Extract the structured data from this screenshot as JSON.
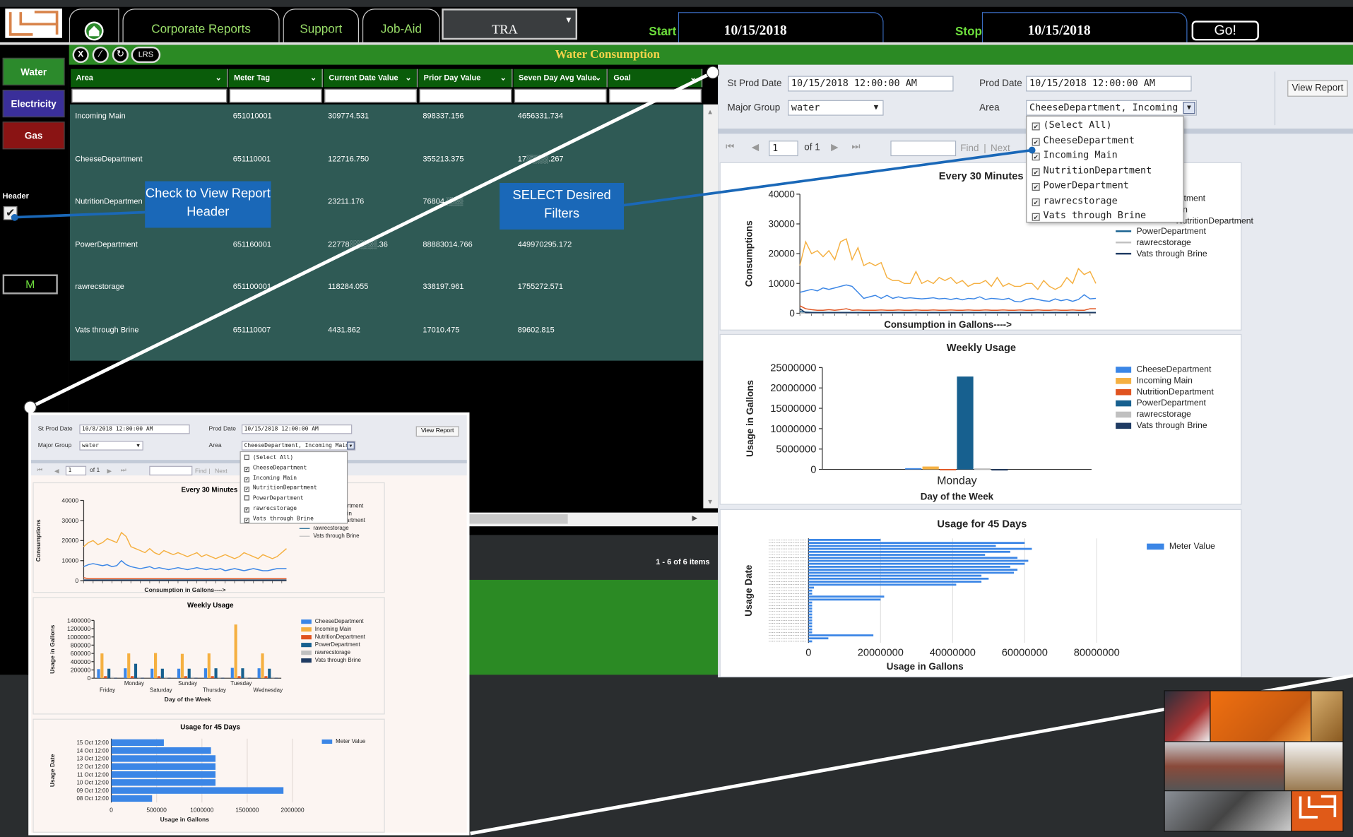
{
  "nav": {
    "tabs": [
      "Corporate Reports",
      "Support",
      "Job-Aid"
    ],
    "dropdown_value": "TRA",
    "start_label": "Start",
    "start_date": "10/15/2018",
    "stop_label": "Stop",
    "stop_date": "10/15/2018",
    "go_label": "Go!"
  },
  "sidebar": {
    "buttons": [
      {
        "label": "Water",
        "color": "#2c8a2c"
      },
      {
        "label": "Electricity",
        "color": "#3a2f9a"
      },
      {
        "label": "Gas",
        "color": "#8a1414"
      }
    ],
    "header_label": "Header",
    "m_label": "M"
  },
  "toolbar": {
    "x": "X",
    "lrs": "LRS"
  },
  "grid": {
    "title": "Water Consumption",
    "columns": [
      "Area",
      "Meter Tag",
      "Current Date Value",
      "Prior Day Value",
      "Seven Day Avg Value",
      "Goal"
    ],
    "rows": [
      [
        "Incoming Main",
        "651010001",
        "309774.531",
        "898337.156",
        "4656331.734",
        ""
      ],
      [
        "CheeseDepartment",
        "651110001",
        "122716.750",
        "355213.375",
        "17░░░░.267",
        ""
      ],
      [
        "NutritionDepartmen",
        "",
        "23211.176",
        "76804.░░░",
        "",
        ""
      ],
      [
        "PowerDepartment",
        "651160001",
        "22778░░░░░.36",
        "88883014.766",
        "449970295.172",
        ""
      ],
      [
        "rawrecstorage",
        "651100001",
        "118284.055",
        "338197.961",
        "1755272.571",
        ""
      ],
      [
        "Vats through Brine",
        "651110007",
        "4431.862",
        "17010.475",
        "89602.815",
        ""
      ]
    ],
    "pager": "1 - 6 of 6 items"
  },
  "report": {
    "st_prod_date_label": "St Prod Date",
    "st_prod_date": "10/15/2018 12:00:00 AM",
    "prod_date_label": "Prod Date",
    "prod_date": "10/15/2018 12:00:00 AM",
    "major_group_label": "Major Group",
    "major_group": "water",
    "area_label": "Area",
    "area_value": "CheeseDepartment, Incoming Main",
    "view_report": "View Report",
    "page_num": "1",
    "page_of": "of 1",
    "find": "Find",
    "next": "Next",
    "area_options": [
      {
        "label": "(Select All)",
        "checked": true
      },
      {
        "label": "CheeseDepartment",
        "checked": true
      },
      {
        "label": "Incoming Main",
        "checked": true
      },
      {
        "label": "NutritionDepartment",
        "checked": true
      },
      {
        "label": "PowerDepartment",
        "checked": true
      },
      {
        "label": "rawrecstorage",
        "checked": true
      },
      {
        "label": "Vats through Brine",
        "checked": true
      }
    ]
  },
  "callouts": {
    "header": "Check to View Report Header",
    "filters": "SELECT Desired Filters"
  },
  "inset": {
    "st_prod_date": "10/8/2018 12:00:00 AM",
    "prod_date": "10/15/2018 12:00:00 AM",
    "major_group": "water",
    "area_value": "CheeseDepartment, Incoming Main",
    "area_options": [
      {
        "label": "(Select All)",
        "checked": false
      },
      {
        "label": "CheeseDepartment",
        "checked": true
      },
      {
        "label": "Incoming Main",
        "checked": true
      },
      {
        "label": "NutritionDepartment",
        "checked": true
      },
      {
        "label": "PowerDepartment",
        "checked": false
      },
      {
        "label": "rawrecstorage",
        "checked": true
      },
      {
        "label": "Vats through Brine",
        "checked": true
      }
    ]
  },
  "colors": {
    "cheese": "#3b86e6",
    "incoming": "#f5b041",
    "nutrition": "#e0531f",
    "power": "#17608f",
    "rawrec": "#c0c0c0",
    "vats": "#1f3b63"
  },
  "chart_data": [
    {
      "type": "line",
      "title": "Every 30 Minutes",
      "xlabel": "Consumption in Gallons---->",
      "ylabel": "Consumptions",
      "ylim": [
        0,
        40000
      ],
      "yticks": [
        0,
        10000,
        20000,
        30000,
        40000
      ],
      "series": [
        {
          "name": "Incoming Main",
          "values": [
            16000,
            24000,
            20000,
            21000,
            19000,
            21000,
            18000,
            24000,
            25000,
            18000,
            22000,
            16000,
            17000,
            16000,
            17000,
            12000,
            11000,
            11000,
            10000,
            10000,
            14000,
            10000,
            11000,
            10000,
            12000,
            11000,
            12000,
            10000,
            11000,
            9000,
            10000,
            10000,
            11000,
            9000,
            12000,
            9000,
            10000,
            9000,
            9000,
            10000,
            10000,
            8000,
            11000,
            9000,
            8000,
            9000,
            12000,
            10000,
            15000,
            13000,
            14000,
            10000
          ]
        },
        {
          "name": "CheeseDepartment",
          "values": [
            7000,
            7500,
            8000,
            7500,
            8500,
            8000,
            8500,
            9000,
            9500,
            9000,
            7000,
            5000,
            5500,
            6000,
            5000,
            6000,
            5000,
            5500,
            5000,
            5200,
            5000,
            4800,
            5000,
            5200,
            4800,
            5000,
            4600,
            5000,
            4500,
            5000,
            4800,
            5500,
            4600,
            5000,
            4800,
            4600,
            5000,
            4000,
            3800,
            4600,
            5000,
            4600,
            4200,
            4000,
            4800,
            4200,
            4600,
            4000,
            4600,
            6200,
            4800,
            5000
          ]
        },
        {
          "name": "NutritionDepartment",
          "values": [
            2500,
            1500,
            1200,
            1000,
            1000,
            1200,
            1000,
            1200,
            1500,
            1000,
            1100,
            1000,
            1000,
            1000,
            1100,
            1000,
            1000,
            1100,
            1000,
            1000,
            1100,
            1000,
            1000,
            1100,
            1000,
            1000,
            1100,
            1000,
            1000,
            1100,
            1000,
            1000,
            1100,
            1000,
            1000,
            1100,
            1000,
            1000,
            1100,
            1000,
            1000,
            1100,
            1000,
            1000,
            1100,
            1000,
            1000,
            1100,
            1000,
            1000,
            1500,
            1500
          ]
        },
        {
          "name": "PowerDepartment",
          "values": [
            500,
            400,
            300,
            300,
            300,
            300,
            300,
            300,
            300,
            300,
            300,
            300,
            300,
            300,
            300,
            300,
            300,
            300,
            300,
            300,
            300,
            300,
            300,
            300,
            300,
            300,
            300,
            300,
            300,
            300,
            300,
            300,
            300,
            300,
            300,
            300,
            300,
            300,
            300,
            300,
            300,
            300,
            300,
            300,
            300,
            300,
            300,
            300,
            300,
            300,
            300,
            300
          ]
        },
        {
          "name": "rawrecstorage",
          "values": [
            0,
            0,
            0,
            0,
            0,
            0,
            0,
            0,
            0,
            0,
            0,
            0,
            0,
            0,
            0,
            0,
            0,
            0,
            0,
            0,
            0,
            0,
            0,
            0,
            0,
            0,
            0,
            0,
            0,
            0,
            0,
            0,
            0,
            0,
            0,
            0,
            0,
            0,
            0,
            0,
            0,
            0,
            0,
            0,
            0,
            0,
            0,
            0,
            0,
            0,
            0,
            0
          ]
        },
        {
          "name": "Vats through Brine",
          "values": [
            1500,
            200,
            200,
            200,
            200,
            200,
            200,
            200,
            200,
            200,
            200,
            200,
            200,
            200,
            200,
            200,
            200,
            200,
            200,
            200,
            200,
            200,
            200,
            200,
            200,
            200,
            200,
            200,
            200,
            200,
            200,
            200,
            200,
            200,
            200,
            200,
            200,
            200,
            200,
            200,
            200,
            200,
            200,
            200,
            200,
            200,
            200,
            200,
            200,
            200,
            200,
            200
          ]
        }
      ]
    },
    {
      "type": "bar",
      "title": "Weekly Usage",
      "xlabel": "Day of the Week",
      "ylabel": "Usage in Gallons",
      "categories": [
        "Monday"
      ],
      "ylim": [
        0,
        25000000
      ],
      "yticks": [
        0,
        5000000,
        10000000,
        15000000,
        20000000,
        25000000
      ],
      "series": [
        {
          "name": "CheeseDepartment",
          "values": [
            300000
          ]
        },
        {
          "name": "Incoming Main",
          "values": [
            700000
          ]
        },
        {
          "name": "NutritionDepartment",
          "values": [
            100000
          ]
        },
        {
          "name": "PowerDepartment",
          "values": [
            22800000
          ]
        },
        {
          "name": "rawrecstorage",
          "values": [
            250000
          ]
        },
        {
          "name": "Vats through Brine",
          "values": [
            50000
          ]
        }
      ]
    },
    {
      "type": "bar",
      "title": "Usage for 45 Days",
      "xlabel": "Usage in Gallons",
      "ylabel": "Usage Date",
      "xlim": [
        0,
        80000000
      ],
      "xticks": [
        0,
        20000000,
        40000000,
        60000000,
        80000000
      ],
      "series": [
        {
          "name": "Meter Value",
          "values": [
            20000000,
            60000000,
            52000000,
            62000000,
            56000000,
            49000000,
            58000000,
            61000000,
            60000000,
            56000000,
            58000000,
            57000000,
            48000000,
            50000000,
            48000000,
            41000000,
            1500000,
            1000000,
            1000000,
            21000000,
            20000000,
            1000000,
            1000000,
            1000000,
            1000000,
            1000000,
            1000000,
            1000000,
            1000000,
            1000000,
            1000000,
            1000000,
            18000000,
            5500000,
            1000000
          ]
        }
      ]
    },
    {
      "type": "line",
      "title": "Every 30 Minutes",
      "xlabel": "Consumption in Gallons---->",
      "ylabel": "Consumptions",
      "ylim": [
        0,
        40000
      ],
      "yticks": [
        0,
        10000,
        20000,
        30000,
        40000
      ],
      "series": [
        {
          "name": "Incoming Main",
          "values": [
            17000,
            19000,
            20000,
            18000,
            19000,
            21000,
            20000,
            19000,
            24000,
            22000,
            17000,
            16000,
            15000,
            14000,
            16000,
            14000,
            13000,
            15000,
            14000,
            13000,
            14000,
            13000,
            12000,
            13000,
            14000,
            12000,
            13000,
            12000,
            11000,
            12000,
            13000,
            12000,
            11000,
            12000,
            14000,
            13000,
            12000,
            11000,
            13000,
            12000,
            11000,
            12000,
            14000,
            16000
          ]
        },
        {
          "name": "CheeseDepartment",
          "values": [
            7000,
            8000,
            8500,
            8000,
            7500,
            8000,
            7000,
            7500,
            10000,
            8000,
            7000,
            6500,
            6000,
            6500,
            7000,
            6000,
            6500,
            6000,
            5500,
            6000,
            6500,
            6000,
            5500,
            6000,
            6500,
            6000,
            5500,
            6000,
            5500,
            6000,
            5000,
            5500,
            6000,
            5500,
            5000,
            5500,
            6000,
            5500,
            5000,
            5000,
            5500,
            6000,
            6000,
            6000
          ]
        },
        {
          "name": "NutritionDepartment",
          "values": [
            1500,
            1000,
            1000,
            1000,
            1000,
            1000,
            1000,
            1000,
            1000,
            1000,
            1000,
            1000,
            1000,
            1000,
            1000,
            1000,
            1000,
            1000,
            1000,
            1000,
            1000,
            1000,
            1000,
            1000,
            1000,
            1000,
            1000,
            1000,
            1000,
            1000,
            1000,
            1000,
            1000,
            1000,
            1000,
            1000,
            1000,
            1000,
            1000,
            1000,
            1000,
            1000,
            1000,
            1000
          ]
        },
        {
          "name": "rawrecstorage",
          "values": [
            500,
            500,
            500,
            500,
            500,
            500,
            500,
            500,
            500,
            500,
            500,
            500,
            500,
            500,
            500,
            500,
            500,
            500,
            500,
            500,
            500,
            500,
            500,
            500,
            500,
            500,
            500,
            500,
            500,
            500,
            500,
            500,
            500,
            500,
            500,
            500,
            500,
            500,
            500,
            500,
            500,
            500,
            500,
            500
          ]
        },
        {
          "name": "Vats through Brine",
          "values": [
            300,
            300,
            300,
            300,
            300,
            300,
            300,
            300,
            300,
            300,
            300,
            300,
            300,
            300,
            300,
            300,
            300,
            300,
            300,
            300,
            300,
            300,
            300,
            300,
            300,
            300,
            300,
            300,
            300,
            300,
            300,
            300,
            300,
            300,
            300,
            300,
            300,
            300,
            300,
            300,
            300,
            300,
            300,
            300
          ]
        }
      ]
    },
    {
      "type": "bar",
      "title": "Weekly Usage",
      "xlabel": "Day of the Week",
      "ylabel": "Usage in Gallons",
      "categories": [
        "Friday",
        "Monday",
        "Saturday",
        "Sunday",
        "Thursday",
        "Tuesday",
        "Wednesday"
      ],
      "ylim": [
        0,
        1400000
      ],
      "yticks": [
        0,
        200000,
        400000,
        600000,
        800000,
        1000000,
        1200000,
        1400000
      ],
      "series": [
        {
          "name": "CheeseDepartment",
          "values": [
            220000,
            240000,
            230000,
            230000,
            240000,
            250000,
            240000
          ]
        },
        {
          "name": "Incoming Main",
          "values": [
            600000,
            600000,
            610000,
            590000,
            600000,
            1300000,
            600000
          ]
        },
        {
          "name": "NutritionDepartment",
          "values": [
            50000,
            50000,
            50000,
            50000,
            50000,
            50000,
            50000
          ]
        },
        {
          "name": "PowerDepartment",
          "values": [
            230000,
            350000,
            230000,
            230000,
            240000,
            240000,
            230000
          ]
        },
        {
          "name": "rawrecstorage",
          "values": [
            30000,
            30000,
            30000,
            30000,
            30000,
            30000,
            30000
          ]
        },
        {
          "name": "Vats through Brine",
          "values": [
            10000,
            10000,
            10000,
            10000,
            10000,
            10000,
            10000
          ]
        }
      ]
    },
    {
      "type": "bar",
      "title": "Usage for 45 Days",
      "xlabel": "Usage in Gallons",
      "ylabel": "Usage Date",
      "categories": [
        "15 Oct 12:00",
        "14 Oct 12:00",
        "13 Oct 12:00",
        "12 Oct 12:00",
        "11 Oct 12:00",
        "10 Oct 12:00",
        "09 Oct 12:00",
        "08 Oct 12:00"
      ],
      "xlim": [
        0,
        2000000
      ],
      "xticks": [
        0,
        500000,
        1000000,
        1500000,
        2000000
      ],
      "series": [
        {
          "name": "Meter Value",
          "values": [
            580000,
            1100000,
            1150000,
            1150000,
            1150000,
            1150000,
            1900000,
            450000
          ]
        }
      ]
    }
  ]
}
